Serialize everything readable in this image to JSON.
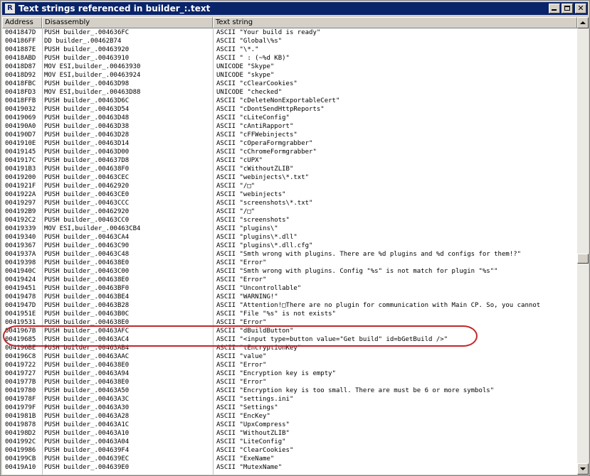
{
  "window": {
    "title": "Text strings referenced in builder_:.text",
    "app_icon_letter": "R"
  },
  "columns": [
    "Address",
    "Disassembly",
    "Text string"
  ],
  "scroll": {
    "position": 0.53
  },
  "rows": [
    {
      "addr": "0041847D",
      "dis": "PUSH builder_.004636FC",
      "txt": "ASCII \"Your build is ready\""
    },
    {
      "addr": "004186FF",
      "dis": "DD builder_.00462B74",
      "txt": "ASCII \"Global\\%s\""
    },
    {
      "addr": "0041887E",
      "dis": "PUSH builder_.00463920",
      "txt": "ASCII \"\\*.\""
    },
    {
      "addr": "00418ABD",
      "dis": "PUSH builder_.00463910",
      "txt": "ASCII \" : (~%d KB)\""
    },
    {
      "addr": "00418D87",
      "dis": "MOV ESI,builder_.00463930",
      "txt": "UNICODE \"Skype\""
    },
    {
      "addr": "00418D92",
      "dis": "MOV ESI,builder_.00463924",
      "txt": "UNICODE \"skype\""
    },
    {
      "addr": "00418FBC",
      "dis": "PUSH builder_.00463D98",
      "txt": "ASCII \"cClearCookies\""
    },
    {
      "addr": "00418FD3",
      "dis": "MOV ESI,builder_.00463D88",
      "txt": "UNICODE \"checked\""
    },
    {
      "addr": "00418FFB",
      "dis": "PUSH builder_.00463D6C",
      "txt": "ASCII \"cDeleteNonExportableCert\""
    },
    {
      "addr": "00419032",
      "dis": "PUSH builder_.00463D54",
      "txt": "ASCII \"cDontSendHttpReports\""
    },
    {
      "addr": "00419069",
      "dis": "PUSH builder_.00463D48",
      "txt": "ASCII \"cLiteConfig\""
    },
    {
      "addr": "004190A0",
      "dis": "PUSH builder_.00463D38",
      "txt": "ASCII \"cAntiRapport\""
    },
    {
      "addr": "004190D7",
      "dis": "PUSH builder_.00463D28",
      "txt": "ASCII \"cFFWebinjects\""
    },
    {
      "addr": "0041910E",
      "dis": "PUSH builder_.00463D14",
      "txt": "ASCII \"cOperaFormgrabber\""
    },
    {
      "addr": "00419145",
      "dis": "PUSH builder_.00463D00",
      "txt": "ASCII \"cChromeFormgrabber\""
    },
    {
      "addr": "0041917C",
      "dis": "PUSH builder_.004637D8",
      "txt": "ASCII \"cUPX\""
    },
    {
      "addr": "004191B3",
      "dis": "PUSH builder_.004638F0",
      "txt": "ASCII \"cWithoutZLIB\""
    },
    {
      "addr": "00419200",
      "dis": "PUSH builder_.00463CEC",
      "txt": "ASCII \"webinjects\\*.txt\""
    },
    {
      "addr": "0041921F",
      "dis": "PUSH builder_.00462920",
      "txt": "ASCII \"/□\""
    },
    {
      "addr": "0041922A",
      "dis": "PUSH builder_.00463CE0",
      "txt": "ASCII \"webinjects\""
    },
    {
      "addr": "00419297",
      "dis": "PUSH builder_.00463CCC",
      "txt": "ASCII \"screenshots\\*.txt\""
    },
    {
      "addr": "004192B9",
      "dis": "PUSH builder_.00462920",
      "txt": "ASCII \"/□\""
    },
    {
      "addr": "004192C2",
      "dis": "PUSH builder_.00463CC0",
      "txt": "ASCII \"screenshots\""
    },
    {
      "addr": "00419339",
      "dis": "MOV ESI,builder_.00463CB4",
      "txt": "ASCII \"plugins\\\""
    },
    {
      "addr": "00419340",
      "dis": "PUSH builder_.00463CA4",
      "txt": "ASCII \"plugins\\*.dll\""
    },
    {
      "addr": "00419367",
      "dis": "PUSH builder_.00463C90",
      "txt": "ASCII \"plugins\\*.dll.cfg\""
    },
    {
      "addr": "0041937A",
      "dis": "PUSH builder_.00463C48",
      "txt": "ASCII \"Smth wrong with plugins. There are %d plugins and %d configs for them!?\""
    },
    {
      "addr": "00419398",
      "dis": "PUSH builder_.004638E0",
      "txt": "ASCII \"Error\""
    },
    {
      "addr": "0041940C",
      "dis": "PUSH builder_.00463C00",
      "txt": "ASCII \"Smth wrong with plugins. Config \"%s\" is not match for plugin \"%s\"\""
    },
    {
      "addr": "00419424",
      "dis": "PUSH builder_.004638E0",
      "txt": "ASCII \"Error\""
    },
    {
      "addr": "00419451",
      "dis": "PUSH builder_.00463BF0",
      "txt": "ASCII \"Uncontrollable\""
    },
    {
      "addr": "00419478",
      "dis": "PUSH builder_.00463BE4",
      "txt": "ASCII \"WARNING!\""
    },
    {
      "addr": "0041947D",
      "dis": "PUSH builder_.00463B28",
      "txt": "ASCII \"Attention!□There are no plugin for communication with Main CP. So, you cannot"
    },
    {
      "addr": "0041951E",
      "dis": "PUSH builder_.00463B0C",
      "txt": "ASCII \"File \"%s\" is not exists\""
    },
    {
      "addr": "00419531",
      "dis": "PUSH builder_.004638E0",
      "txt": "ASCII \"Error\""
    },
    {
      "addr": "0041967B",
      "dis": "PUSH builder_.00463AFC",
      "txt": "ASCII \"dBuildButton\""
    },
    {
      "addr": "00419685",
      "dis": "PUSH builder_.00463AC4",
      "txt": "ASCII \"<input type=button value=\"Get build\" id=bGetBuild />\""
    },
    {
      "addr": "004196BE",
      "dis": "PUSH builder_.00463AB4",
      "txt": "ASCII \"tEncryptionKey\""
    },
    {
      "addr": "004196C8",
      "dis": "PUSH builder_.00463AAC",
      "txt": "ASCII \"value\""
    },
    {
      "addr": "00419722",
      "dis": "PUSH builder_.004638E0",
      "txt": "ASCII \"Error\""
    },
    {
      "addr": "00419727",
      "dis": "PUSH builder_.00463A94",
      "txt": "ASCII \"Encryption key is empty\""
    },
    {
      "addr": "0041977B",
      "dis": "PUSH builder_.004638E0",
      "txt": "ASCII \"Error\""
    },
    {
      "addr": "00419780",
      "dis": "PUSH builder_.00463A50",
      "txt": "ASCII \"Encryption key is too small. There are must be 6 or more symbols\""
    },
    {
      "addr": "0041978F",
      "dis": "PUSH builder_.00463A3C",
      "txt": "ASCII \"settings.ini\""
    },
    {
      "addr": "0041979F",
      "dis": "PUSH builder_.00463A30",
      "txt": "ASCII \"Settings\""
    },
    {
      "addr": "0041981B",
      "dis": "PUSH builder_.00463A28",
      "txt": "ASCII \"EncKey\""
    },
    {
      "addr": "00419878",
      "dis": "PUSH builder_.00463A1C",
      "txt": "ASCII \"UpxCompress\""
    },
    {
      "addr": "004198D2",
      "dis": "PUSH builder_.00463A10",
      "txt": "ASCII \"WithoutZLIB\""
    },
    {
      "addr": "0041992C",
      "dis": "PUSH builder_.00463A04",
      "txt": "ASCII \"LiteConfig\""
    },
    {
      "addr": "00419986",
      "dis": "PUSH builder_.004639F4",
      "txt": "ASCII \"ClearCookies\""
    },
    {
      "addr": "004199CB",
      "dis": "PUSH builder_.004639EC",
      "txt": "ASCII \"ExeName\""
    },
    {
      "addr": "00419A10",
      "dis": "PUSH builder_.004639E0",
      "txt": "ASCII \"MutexName\""
    }
  ]
}
